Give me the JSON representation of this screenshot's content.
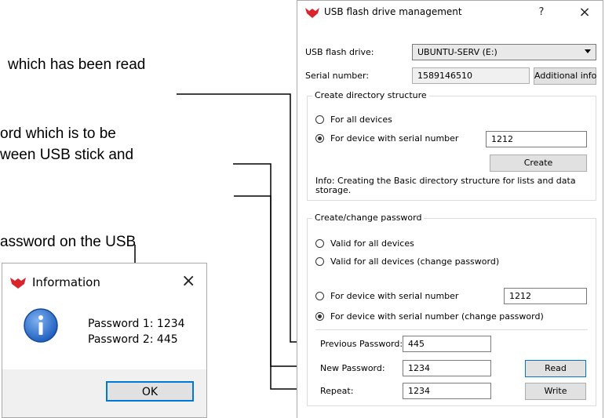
{
  "callouts": {
    "line1": "which has been read",
    "line2a": "ord which is to be",
    "line2b": "ween USB stick and",
    "line3": "assword on the USB"
  },
  "main_window": {
    "title": "USB flash drive management",
    "help_glyph": "?",
    "close_glyph": "×",
    "usb_label": "USB flash drive:",
    "usb_value": "UBUNTU-SERV (E:)",
    "serial_label": "Serial number:",
    "serial_value": "1589146510",
    "additional_info": "Additional info",
    "dir_group": {
      "title": "Create directory structure",
      "opt_all": "For all devices",
      "opt_serial": "For device with serial number",
      "serial_value": "1212",
      "create_btn": "Create",
      "info": "Info: Creating the Basic directory structure for lists and data storage."
    },
    "pw_group": {
      "title": "Create/change password",
      "opt_valid_all": "Valid for all devices",
      "opt_valid_all_change": "Valid for all devices (change password)",
      "opt_serial": "For device with serial number",
      "serial_value": "1212",
      "opt_serial_change": "For device with serial number (change password)",
      "prev_label": "Previous Password:",
      "prev_value": "445",
      "new_label": "New Password:",
      "new_value": "1234",
      "repeat_label": "Repeat:",
      "repeat_value": "1234",
      "read_btn": "Read",
      "write_btn": "Write"
    }
  },
  "info_dialog": {
    "title": "Information",
    "close_glyph": "×",
    "line1": "Password 1: 1234",
    "line2": "Password 2: 445",
    "ok": "OK"
  },
  "colors": {
    "logo_red": "#d9262c",
    "info_blue": "#1f5fbf",
    "focus_blue": "#0078d7"
  }
}
